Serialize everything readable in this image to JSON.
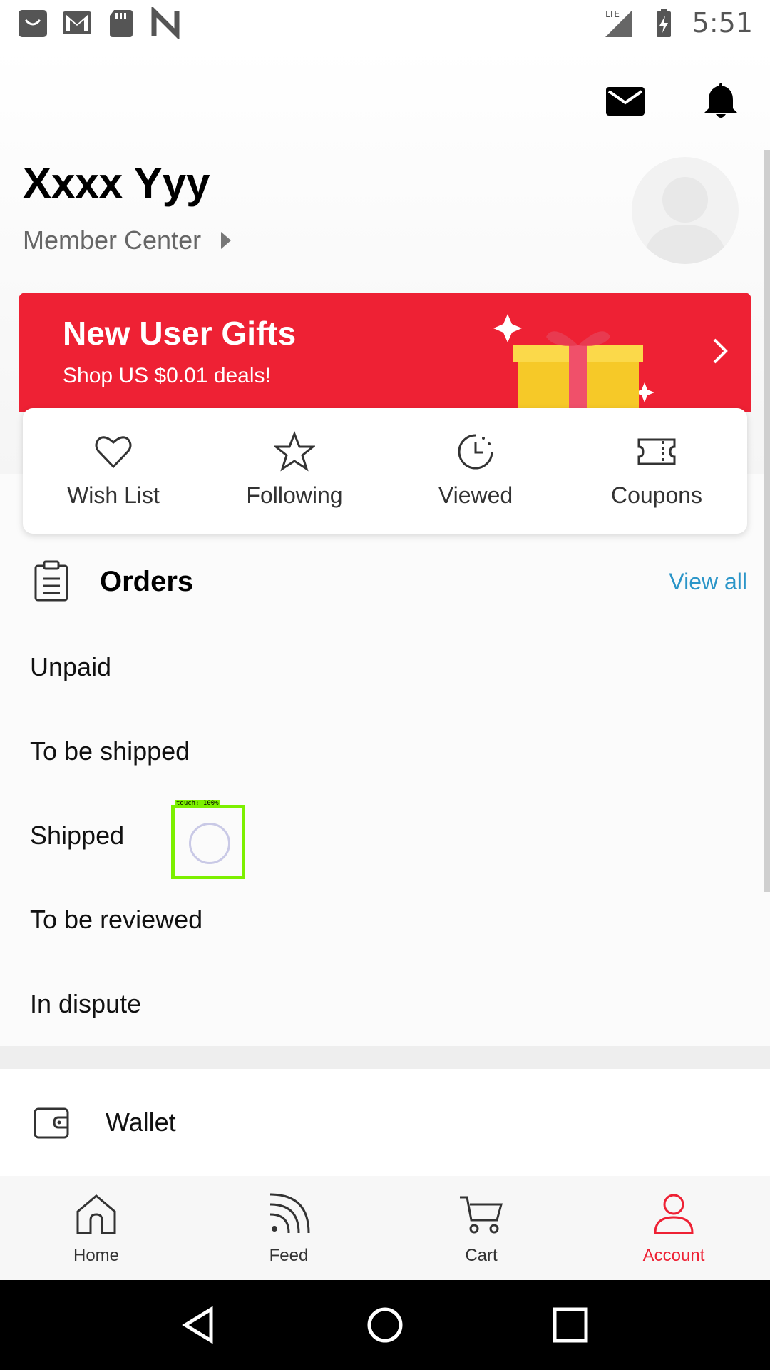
{
  "status_bar": {
    "time": "5:51",
    "network": "LTE",
    "icons": [
      "shopping-bag-icon",
      "gmail-icon",
      "sd-card-icon",
      "n-icon",
      "signal-icon",
      "battery-icon"
    ]
  },
  "header": {
    "icons": [
      "mail-icon",
      "bell-icon"
    ],
    "username": "Xxxx Yyy",
    "member_center": "Member Center"
  },
  "banner": {
    "title": "New User Gifts",
    "subtitle": "Shop US $0.01 deals!",
    "color": "#ee2134"
  },
  "quick_links": [
    {
      "label": "Wish List",
      "icon": "heart-icon"
    },
    {
      "label": "Following",
      "icon": "star-icon"
    },
    {
      "label": "Viewed",
      "icon": "clock-icon"
    },
    {
      "label": "Coupons",
      "icon": "coupon-icon"
    }
  ],
  "orders": {
    "title": "Orders",
    "view_all": "View all",
    "items": [
      "Unpaid",
      "To be shipped",
      "Shipped",
      "To be reviewed",
      "In dispute"
    ]
  },
  "wallet": {
    "label": "Wallet"
  },
  "touch_indicator": {
    "label": "touch: 100%"
  },
  "bottom_nav": [
    {
      "label": "Home",
      "icon": "home-icon",
      "active": false
    },
    {
      "label": "Feed",
      "icon": "feed-icon",
      "active": false
    },
    {
      "label": "Cart",
      "icon": "cart-icon",
      "active": false
    },
    {
      "label": "Account",
      "icon": "account-icon",
      "active": true
    }
  ],
  "colors": {
    "accent": "#ee2134",
    "link": "#2b95c8"
  }
}
